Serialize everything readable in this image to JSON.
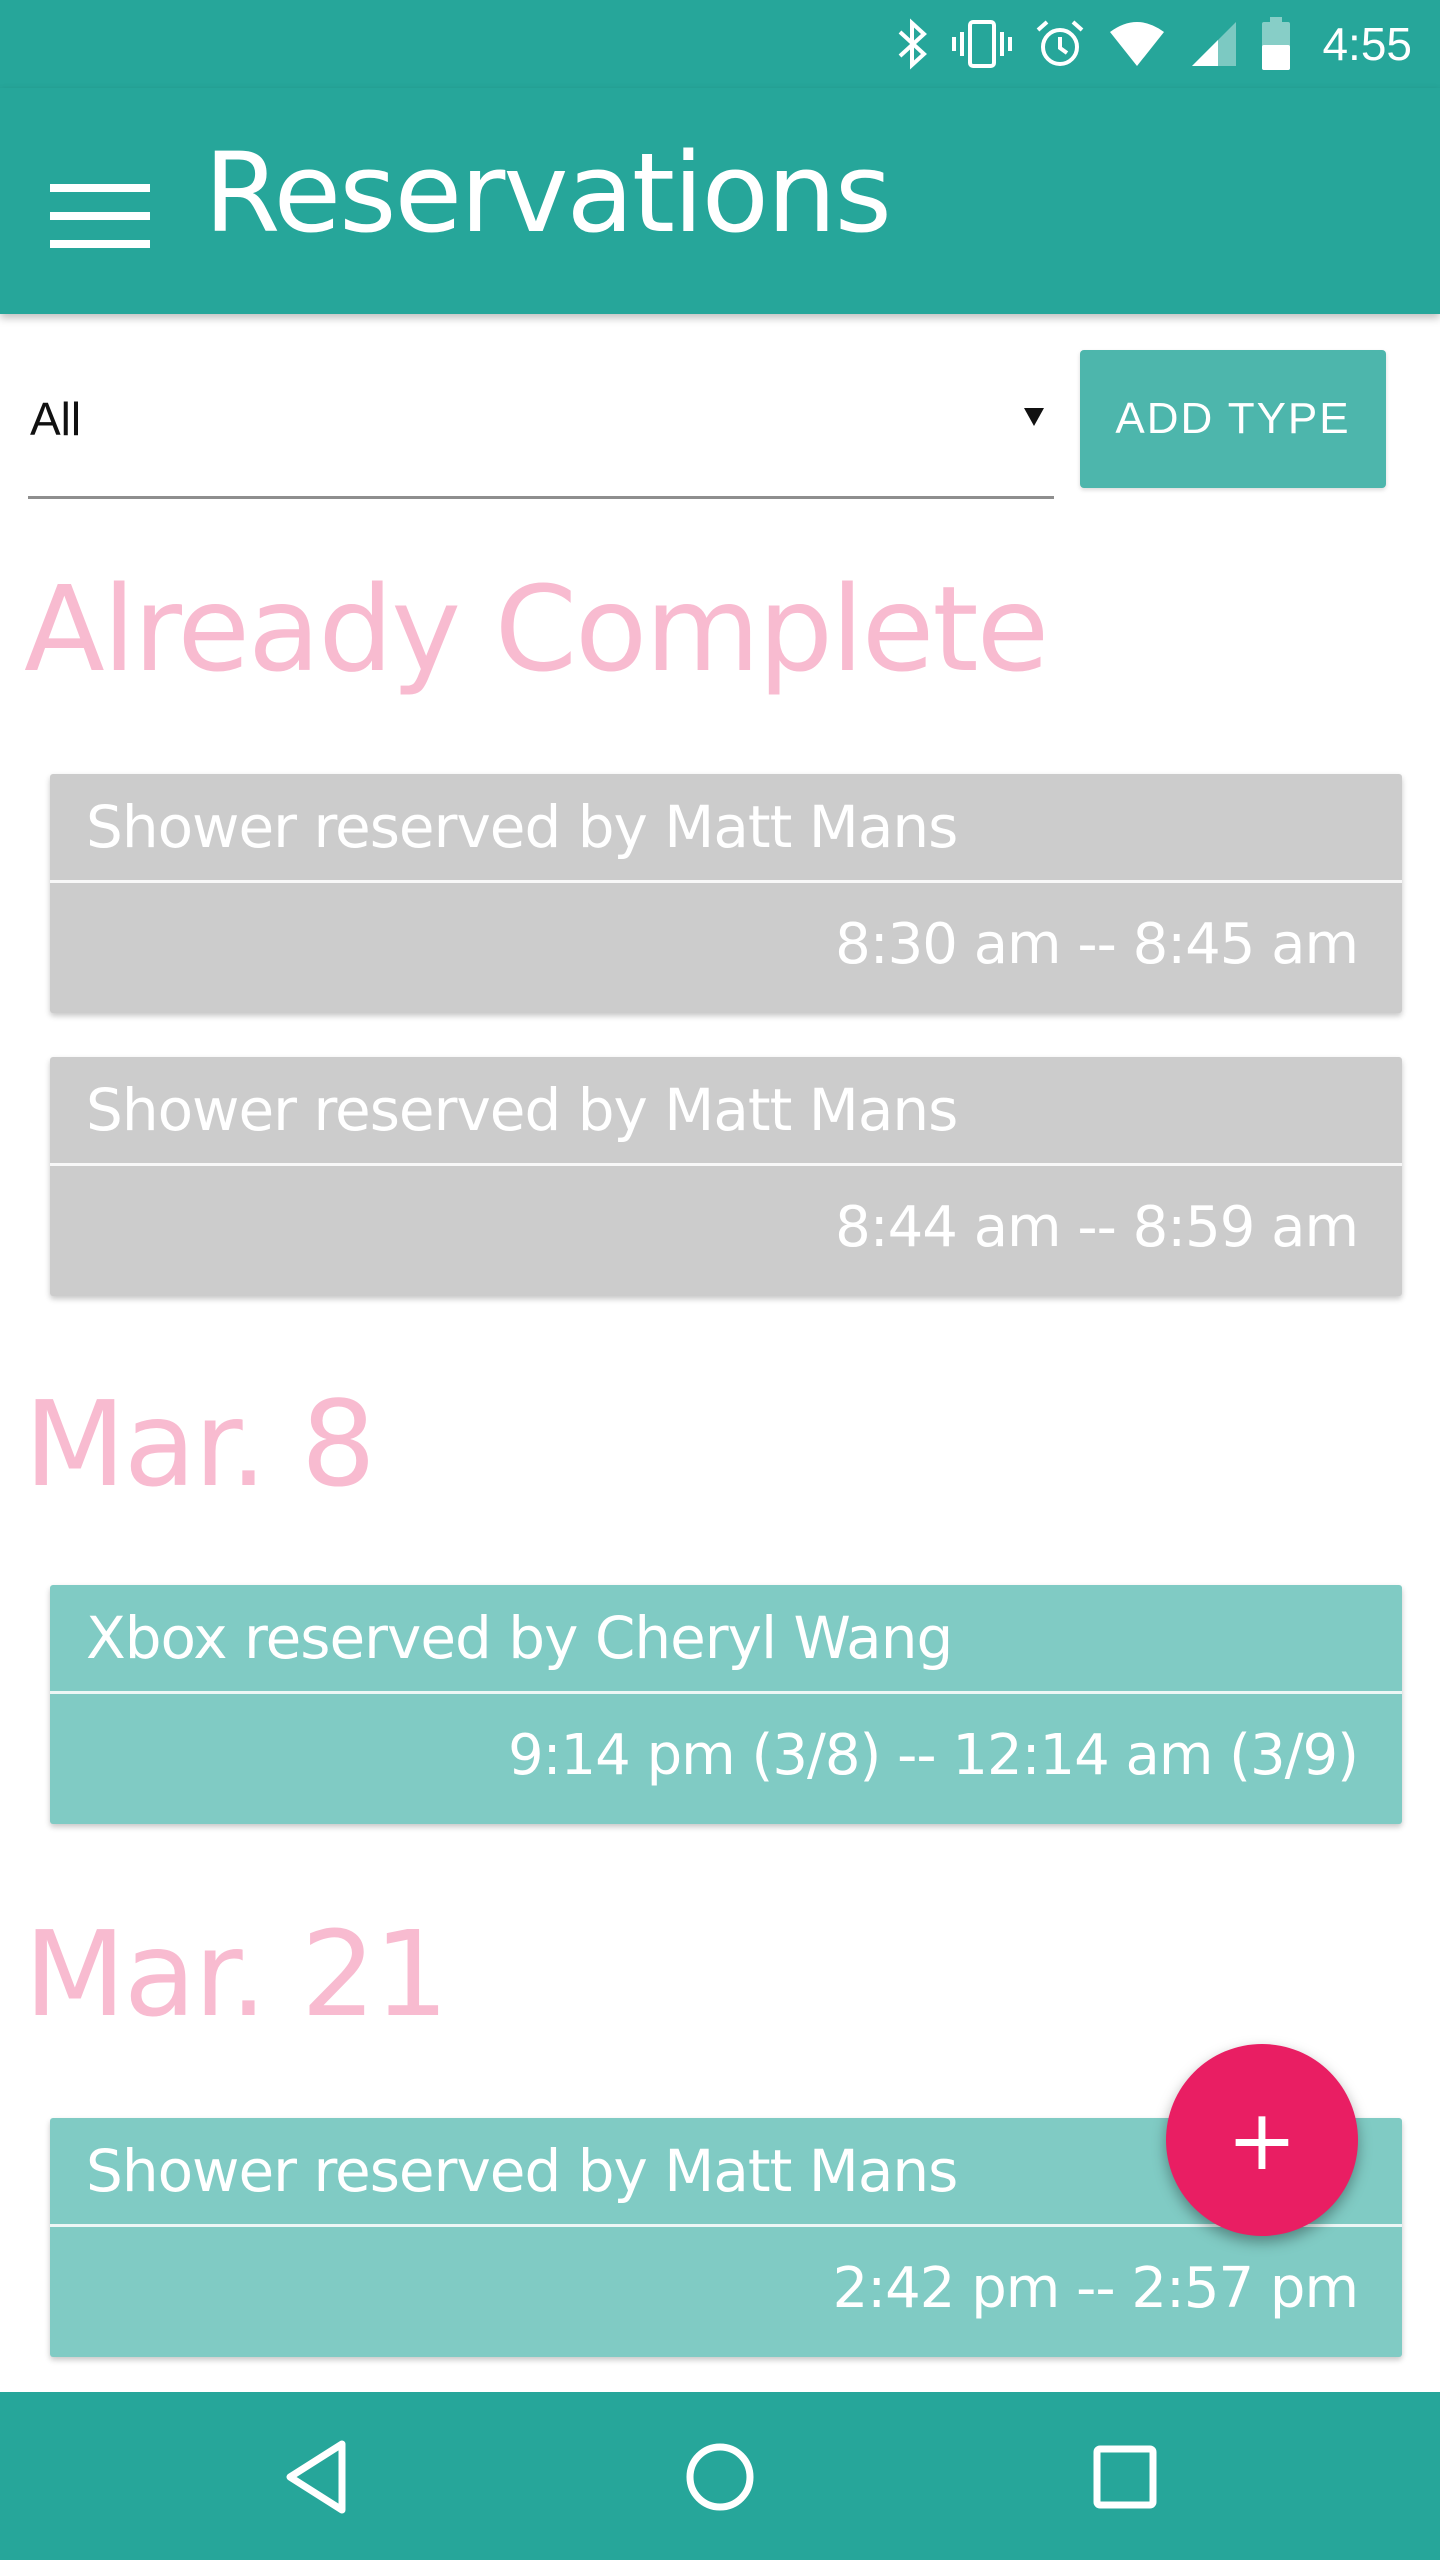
{
  "status_bar": {
    "time": "4:55",
    "icons": [
      "bluetooth-icon",
      "vibrate-icon",
      "alarm-icon",
      "wifi-icon",
      "signal-icon",
      "battery-icon"
    ]
  },
  "app_bar": {
    "title": "Reservations",
    "menu_icon": "menu-icon"
  },
  "filter": {
    "selected": "All",
    "add_type_label": "ADD TYPE"
  },
  "sections": [
    {
      "header": "Already Complete",
      "cards": [
        {
          "title": "Shower reserved by Matt Mans",
          "time": "8:30 am -- 8:45 am"
        },
        {
          "title": "Shower reserved by Matt Mans",
          "time": "8:44 am -- 8:59 am"
        }
      ]
    },
    {
      "header": "Mar. 8",
      "cards": [
        {
          "title": "Xbox reserved by Cheryl Wang",
          "time": "9:14 pm (3/8) -- 12:14 am (3/9)"
        }
      ]
    },
    {
      "header": "Mar. 21",
      "cards": [
        {
          "title": "Shower reserved by Matt Mans",
          "time": "2:42 pm -- 2:57 pm"
        }
      ]
    }
  ],
  "fab": {
    "label": "+"
  },
  "nav_bar": {
    "icons": [
      "back-icon",
      "home-icon",
      "recents-icon"
    ]
  },
  "colors": {
    "primary": "#26a69a",
    "accent": "#e91e63",
    "section_header": "#f8bbd0",
    "complete_card": "#cccccc",
    "upcoming_card": "#80cbc4",
    "add_type_button": "#4db6ac"
  }
}
